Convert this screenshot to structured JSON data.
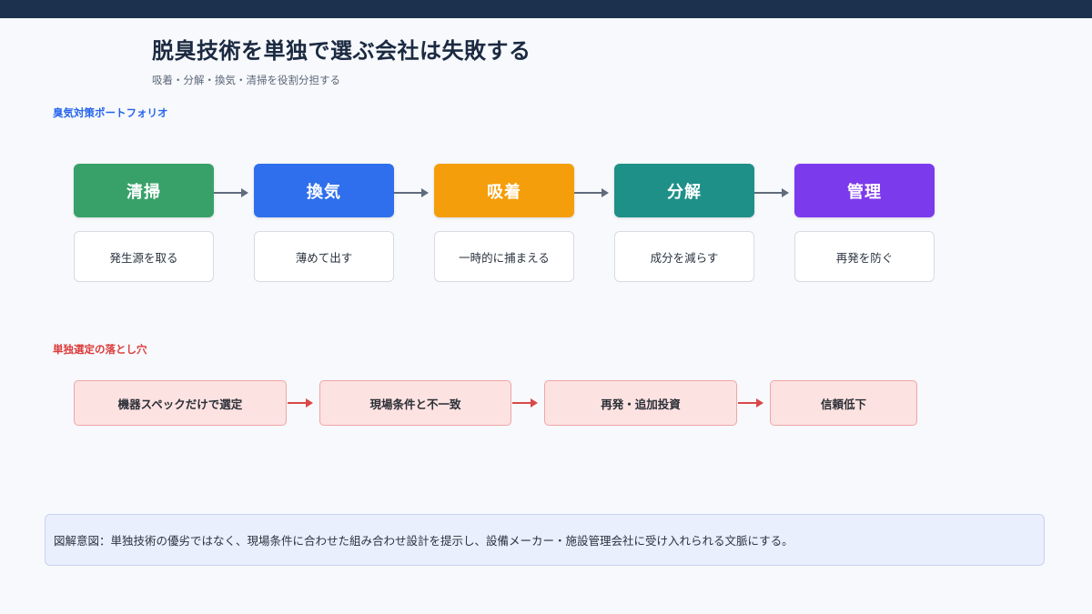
{
  "title": "脱臭技術を単独で選ぶ会社は失敗する",
  "subtitle": "吸着・分解・換気・清掃を役割分担する",
  "portfolio": {
    "label": "臭気対策ポートフォリオ",
    "steps": [
      {
        "name": "清掃",
        "desc": "発生源を取る",
        "color": "#38a169"
      },
      {
        "name": "換気",
        "desc": "薄めて出す",
        "color": "#2f6fed"
      },
      {
        "name": "吸着",
        "desc": "一時的に捕まえる",
        "color": "#f59e0b"
      },
      {
        "name": "分解",
        "desc": "成分を減らす",
        "color": "#1e9088"
      },
      {
        "name": "管理",
        "desc": "再発を防ぐ",
        "color": "#7c3aed"
      }
    ]
  },
  "pitfalls": {
    "label": "単独選定の落とし穴",
    "steps": [
      "機器スペックだけで選定",
      "現場条件と不一致",
      "再発・追加投資",
      "信頼低下"
    ]
  },
  "note": "図解意図：単独技術の優劣ではなく、現場条件に合わせた組み合わせ設計を提示し、設備メーカー・施設管理会社に受け入れられる文脈にする。"
}
